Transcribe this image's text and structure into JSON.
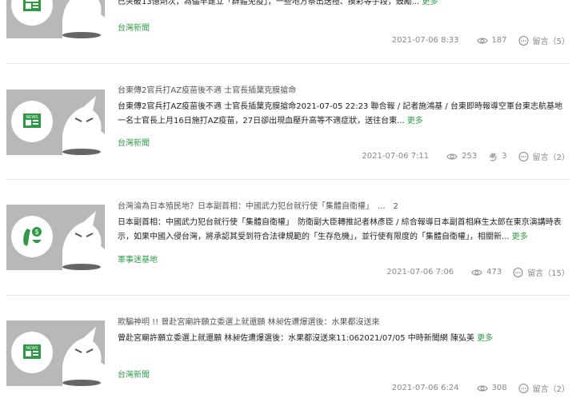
{
  "articles": [
    {
      "title": "",
      "excerpt": "已突破13億劑次，為儘早建立「群體免疫」，一些地方祭出送禮、摸彩等手段，鼓勵...",
      "more": "更多",
      "source": "台灣新聞",
      "date": "2021-07-06 8:33",
      "views": "187",
      "likes": "",
      "comments": "留言（5）",
      "thumb_icon": "newspaper-icon"
    },
    {
      "title": "台東傳2官兵打AZ疫苗後不適 士官長插葉克膜搶命",
      "excerpt": "台東傳2官兵打AZ疫苗後不適 士官長插葉克膜搶命2021-07-05 22:23 聯合報 / 記者施鴻基 / 台東即時報導空軍台東志航基地一名士官長上月16日施打AZ疫苗，27日卻出現血壓升高等不適症狀，送往台東...",
      "more": "更多",
      "source": "台灣新聞",
      "date": "2021-07-06 7:11",
      "views": "253",
      "likes": "3",
      "comments": "留言（2）",
      "thumb_icon": "newspaper-icon"
    },
    {
      "title": "台灣淪為日本殖民地？日本副首相：中國武力犯台就行使「集體自衛權」　...　2",
      "excerpt": "日本副首相：中國武力犯台就行使「集體自衛權」　防衛副大臣轉推記者林彥臣 / 綜合報導日本副首相麻生太郎在東京演講時表示，如果中國入侵台灣，將承認其受到符合法律規範的「生存危機」，並行使有限度的「集體自衛權」，相關新...",
      "more": "更多",
      "source": "軍事迷基地",
      "date": "2021-07-06 7:06",
      "views": "473",
      "likes": "",
      "comments": "留言（15）",
      "thumb_icon": "taiwan-dollar-icon"
    },
    {
      "title": "欺騙神明 !! 曾赴宮廟許願立委選上就還願 林昶佐遭爆選後：水果都沒送來",
      "excerpt": "曾赴宮廟許願立委選上就還願 林昶佐遭爆選後：水果都沒送來11:062021/07/05 中時新聞網 陳弘美",
      "more": "更多",
      "source": "台灣新聞",
      "date": "2021-07-06 6:24",
      "views": "308",
      "likes": "",
      "comments": "留言（2）",
      "thumb_icon": "newspaper-icon"
    }
  ],
  "colors": {
    "accent": "#2e9a45",
    "thumb_bg": "#b8b8b8",
    "meta": "#888888"
  }
}
